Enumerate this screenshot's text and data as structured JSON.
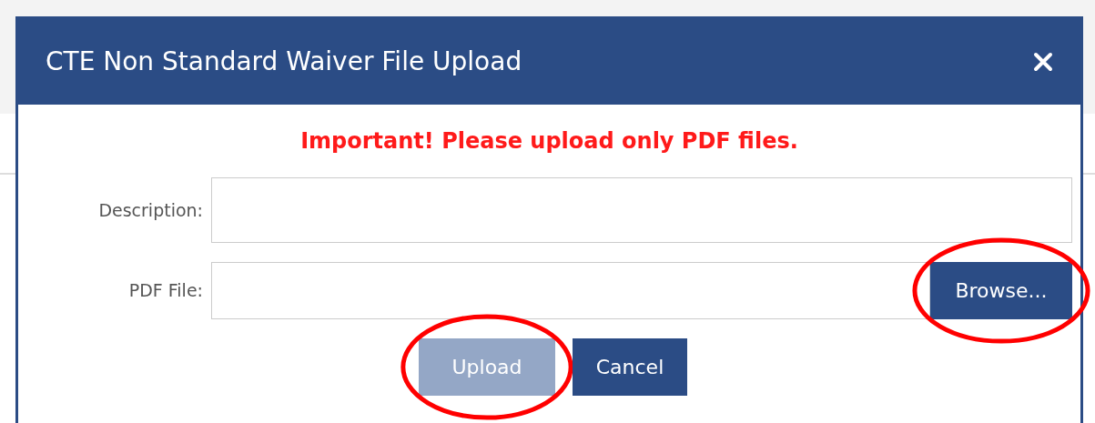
{
  "dialog": {
    "title": "CTE Non Standard Waiver File Upload",
    "warning": "Important! Please upload only PDF files.",
    "fields": [
      {
        "label": "Description:",
        "kind": "text"
      },
      {
        "label": "PDF File:",
        "kind": "file",
        "button": {
          "label": "Browse...",
          "disabled": false,
          "highlighted": true
        }
      }
    ],
    "buttons": [
      {
        "label": "Upload",
        "disabled": true,
        "highlighted": true
      },
      {
        "label": "Cancel",
        "disabled": false,
        "highlighted": false
      }
    ]
  }
}
